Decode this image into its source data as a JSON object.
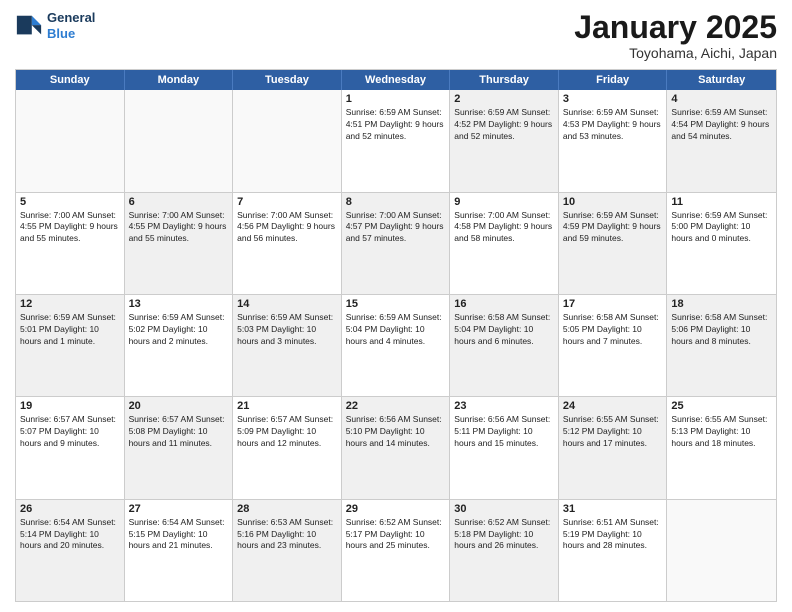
{
  "header": {
    "logo_line1": "General",
    "logo_line2": "Blue",
    "month": "January 2025",
    "location": "Toyohama, Aichi, Japan"
  },
  "weekdays": [
    "Sunday",
    "Monday",
    "Tuesday",
    "Wednesday",
    "Thursday",
    "Friday",
    "Saturday"
  ],
  "rows": [
    [
      {
        "day": "",
        "info": "",
        "empty": true
      },
      {
        "day": "",
        "info": "",
        "empty": true
      },
      {
        "day": "",
        "info": "",
        "empty": true
      },
      {
        "day": "1",
        "info": "Sunrise: 6:59 AM\nSunset: 4:51 PM\nDaylight: 9 hours\nand 52 minutes.",
        "shaded": false
      },
      {
        "day": "2",
        "info": "Sunrise: 6:59 AM\nSunset: 4:52 PM\nDaylight: 9 hours\nand 52 minutes.",
        "shaded": true
      },
      {
        "day": "3",
        "info": "Sunrise: 6:59 AM\nSunset: 4:53 PM\nDaylight: 9 hours\nand 53 minutes.",
        "shaded": false
      },
      {
        "day": "4",
        "info": "Sunrise: 6:59 AM\nSunset: 4:54 PM\nDaylight: 9 hours\nand 54 minutes.",
        "shaded": true
      }
    ],
    [
      {
        "day": "5",
        "info": "Sunrise: 7:00 AM\nSunset: 4:55 PM\nDaylight: 9 hours\nand 55 minutes.",
        "shaded": false
      },
      {
        "day": "6",
        "info": "Sunrise: 7:00 AM\nSunset: 4:55 PM\nDaylight: 9 hours\nand 55 minutes.",
        "shaded": true
      },
      {
        "day": "7",
        "info": "Sunrise: 7:00 AM\nSunset: 4:56 PM\nDaylight: 9 hours\nand 56 minutes.",
        "shaded": false
      },
      {
        "day": "8",
        "info": "Sunrise: 7:00 AM\nSunset: 4:57 PM\nDaylight: 9 hours\nand 57 minutes.",
        "shaded": true
      },
      {
        "day": "9",
        "info": "Sunrise: 7:00 AM\nSunset: 4:58 PM\nDaylight: 9 hours\nand 58 minutes.",
        "shaded": false
      },
      {
        "day": "10",
        "info": "Sunrise: 6:59 AM\nSunset: 4:59 PM\nDaylight: 9 hours\nand 59 minutes.",
        "shaded": true
      },
      {
        "day": "11",
        "info": "Sunrise: 6:59 AM\nSunset: 5:00 PM\nDaylight: 10 hours\nand 0 minutes.",
        "shaded": false
      }
    ],
    [
      {
        "day": "12",
        "info": "Sunrise: 6:59 AM\nSunset: 5:01 PM\nDaylight: 10 hours\nand 1 minute.",
        "shaded": true
      },
      {
        "day": "13",
        "info": "Sunrise: 6:59 AM\nSunset: 5:02 PM\nDaylight: 10 hours\nand 2 minutes.",
        "shaded": false
      },
      {
        "day": "14",
        "info": "Sunrise: 6:59 AM\nSunset: 5:03 PM\nDaylight: 10 hours\nand 3 minutes.",
        "shaded": true
      },
      {
        "day": "15",
        "info": "Sunrise: 6:59 AM\nSunset: 5:04 PM\nDaylight: 10 hours\nand 4 minutes.",
        "shaded": false
      },
      {
        "day": "16",
        "info": "Sunrise: 6:58 AM\nSunset: 5:04 PM\nDaylight: 10 hours\nand 6 minutes.",
        "shaded": true
      },
      {
        "day": "17",
        "info": "Sunrise: 6:58 AM\nSunset: 5:05 PM\nDaylight: 10 hours\nand 7 minutes.",
        "shaded": false
      },
      {
        "day": "18",
        "info": "Sunrise: 6:58 AM\nSunset: 5:06 PM\nDaylight: 10 hours\nand 8 minutes.",
        "shaded": true
      }
    ],
    [
      {
        "day": "19",
        "info": "Sunrise: 6:57 AM\nSunset: 5:07 PM\nDaylight: 10 hours\nand 9 minutes.",
        "shaded": false
      },
      {
        "day": "20",
        "info": "Sunrise: 6:57 AM\nSunset: 5:08 PM\nDaylight: 10 hours\nand 11 minutes.",
        "shaded": true
      },
      {
        "day": "21",
        "info": "Sunrise: 6:57 AM\nSunset: 5:09 PM\nDaylight: 10 hours\nand 12 minutes.",
        "shaded": false
      },
      {
        "day": "22",
        "info": "Sunrise: 6:56 AM\nSunset: 5:10 PM\nDaylight: 10 hours\nand 14 minutes.",
        "shaded": true
      },
      {
        "day": "23",
        "info": "Sunrise: 6:56 AM\nSunset: 5:11 PM\nDaylight: 10 hours\nand 15 minutes.",
        "shaded": false
      },
      {
        "day": "24",
        "info": "Sunrise: 6:55 AM\nSunset: 5:12 PM\nDaylight: 10 hours\nand 17 minutes.",
        "shaded": true
      },
      {
        "day": "25",
        "info": "Sunrise: 6:55 AM\nSunset: 5:13 PM\nDaylight: 10 hours\nand 18 minutes.",
        "shaded": false
      }
    ],
    [
      {
        "day": "26",
        "info": "Sunrise: 6:54 AM\nSunset: 5:14 PM\nDaylight: 10 hours\nand 20 minutes.",
        "shaded": true
      },
      {
        "day": "27",
        "info": "Sunrise: 6:54 AM\nSunset: 5:15 PM\nDaylight: 10 hours\nand 21 minutes.",
        "shaded": false
      },
      {
        "day": "28",
        "info": "Sunrise: 6:53 AM\nSunset: 5:16 PM\nDaylight: 10 hours\nand 23 minutes.",
        "shaded": true
      },
      {
        "day": "29",
        "info": "Sunrise: 6:52 AM\nSunset: 5:17 PM\nDaylight: 10 hours\nand 25 minutes.",
        "shaded": false
      },
      {
        "day": "30",
        "info": "Sunrise: 6:52 AM\nSunset: 5:18 PM\nDaylight: 10 hours\nand 26 minutes.",
        "shaded": true
      },
      {
        "day": "31",
        "info": "Sunrise: 6:51 AM\nSunset: 5:19 PM\nDaylight: 10 hours\nand 28 minutes.",
        "shaded": false
      },
      {
        "day": "",
        "info": "",
        "empty": true
      }
    ]
  ]
}
